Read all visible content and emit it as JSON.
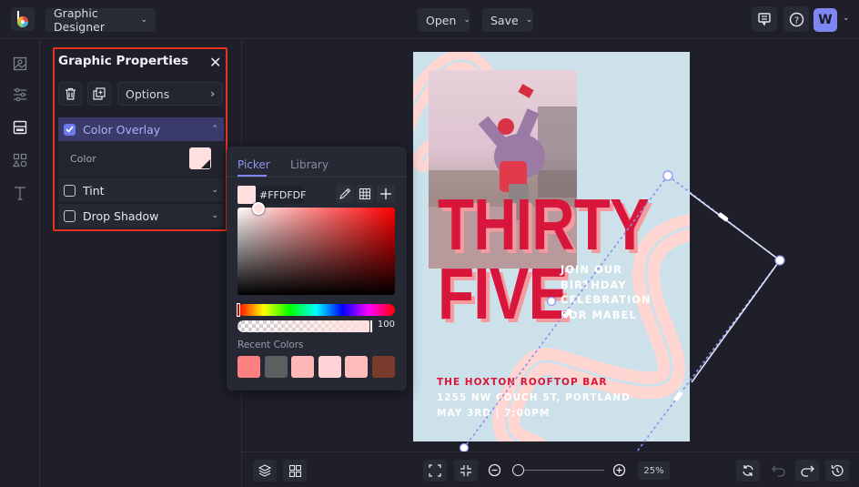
{
  "topbar": {
    "app_mode": "Graphic Designer",
    "open_label": "Open",
    "save_label": "Save",
    "avatar_initial": "W"
  },
  "sidebar": {
    "items": [
      {
        "name": "image-icon"
      },
      {
        "name": "adjustments-icon"
      },
      {
        "name": "graphics-icon",
        "active": true
      },
      {
        "name": "shapes-icon"
      },
      {
        "name": "text-icon"
      }
    ]
  },
  "panel": {
    "title": "Graphic Properties",
    "options_label": "Options",
    "sections": [
      {
        "label": "Color Overlay",
        "checked": true,
        "expanded": true
      },
      {
        "label": "Tint",
        "checked": false,
        "expanded": false
      },
      {
        "label": "Drop Shadow",
        "checked": false,
        "expanded": false
      }
    ],
    "color_label": "Color",
    "overlay_color": "#FFDFDF"
  },
  "picker": {
    "tabs": [
      "Picker",
      "Library"
    ],
    "active_tab": "Picker",
    "hex_value": "#FFDFDF",
    "opacity": "100",
    "recent_label": "Recent Colors",
    "recent_colors": [
      "#FF8080",
      "#5A5F60",
      "#FFB8B5",
      "#FFD3D6",
      "#FFBCBA",
      "#7A3A2C"
    ],
    "accent": "#7D86F2"
  },
  "document": {
    "headline_1": "THIRTY",
    "headline_2": "FIVE",
    "invite_lines": [
      "JOIN OUR",
      "BIRTHDAY",
      "CELEBRATION",
      "FOR MABEL"
    ],
    "venue": "THE HOXTON ROOFTOP BAR",
    "address": "1255 NW COUCH ST, PORTLAND",
    "datetime": "MAY 3RD | 7:00PM",
    "background_color": "#CDE1EA",
    "headline_color": "#D8153A"
  },
  "bottombar": {
    "zoom": "25%",
    "zoom_fraction": 0.05
  }
}
